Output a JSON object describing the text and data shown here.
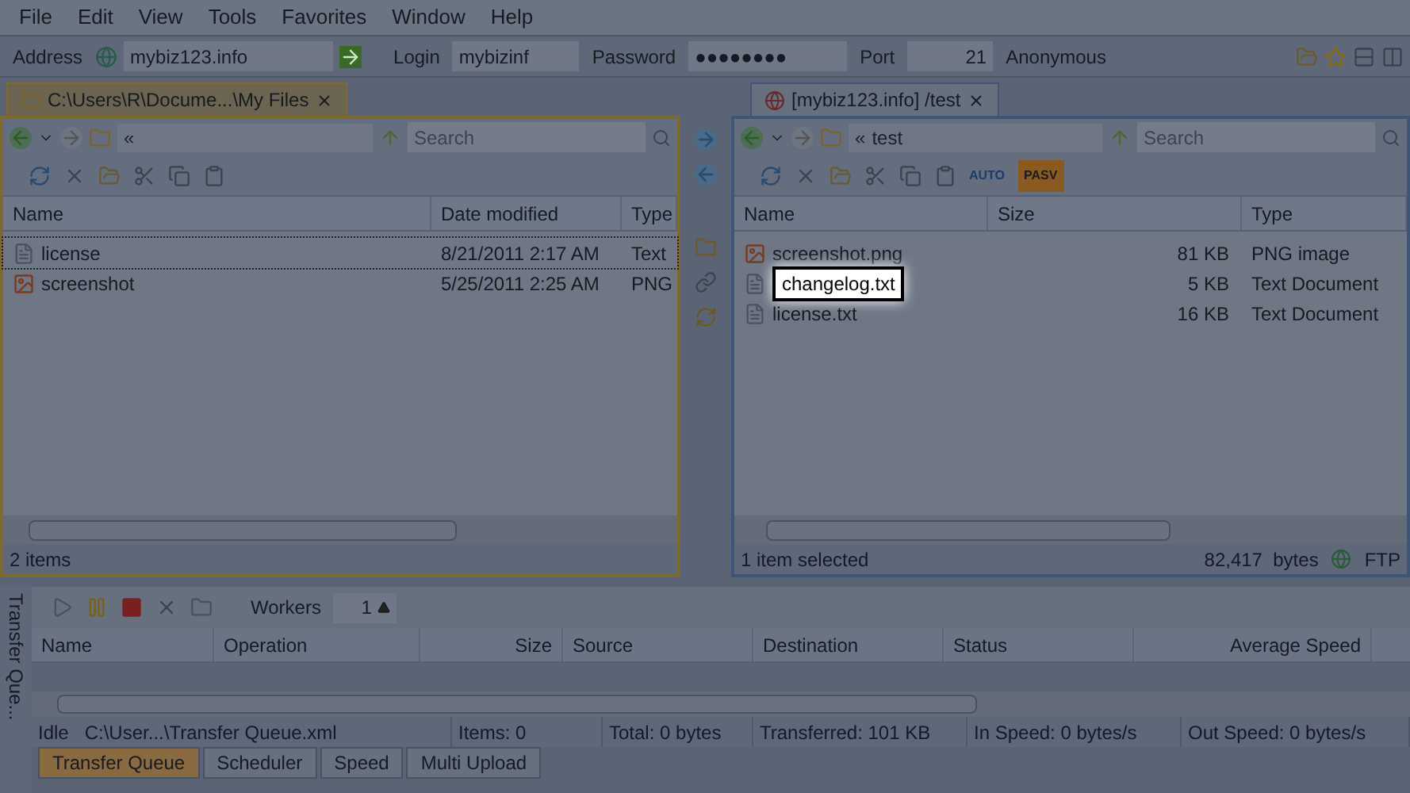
{
  "menu": [
    "File",
    "Edit",
    "View",
    "Tools",
    "Favorites",
    "Window",
    "Help"
  ],
  "connection_bar": {
    "address_label": "Address",
    "address": "mybiz123.info",
    "login_label": "Login",
    "login": "mybizinf",
    "password_label": "Password",
    "password": "●●●●●●●●",
    "port_label": "Port",
    "port": "21",
    "anonymous": "Anonymous"
  },
  "left_pane": {
    "tab_title": "C:\\Users\\R\\Docume...\\My Files",
    "path": "«",
    "search_placeholder": "Search",
    "columns": [
      "Name",
      "Date modified",
      "Type"
    ],
    "rows": [
      {
        "kind": "text",
        "name": "license",
        "date": "8/21/2011 2:17 AM",
        "type": "Text",
        "focused": true
      },
      {
        "kind": "image",
        "name": "screenshot",
        "date": "5/25/2011 2:25 AM",
        "type": "PNG",
        "focused": false
      }
    ],
    "status": "2 items"
  },
  "right_pane": {
    "tab_title": "[mybiz123.info] /test",
    "path": "«",
    "folder": "test",
    "search_placeholder": "Search",
    "pasv": "PASV",
    "auto": "AUTO",
    "columns": [
      "Name",
      "Size",
      "Type"
    ],
    "rows": [
      {
        "kind": "image",
        "name": "screenshot.png",
        "size": "81 KB",
        "type": "PNG image",
        "selected": false
      },
      {
        "kind": "text",
        "name": "changelog.txt",
        "size": "5 KB",
        "type": "Text Document",
        "selected": true
      },
      {
        "kind": "text",
        "name": "license.txt",
        "size": "16 KB",
        "type": "Text Document",
        "selected": false
      }
    ],
    "status": "1 item selected",
    "bytes": "82,417  bytes",
    "protocol": "FTP"
  },
  "queue": {
    "side_label": "Transfer Que...",
    "workers_label": "Workers",
    "workers": "1",
    "columns": [
      "Name",
      "Operation",
      "Size",
      "Source",
      "Destination",
      "Status",
      "Average Speed"
    ],
    "status_cells": [
      "Idle   C:\\User...\\Transfer Queue.xml",
      "Items: 0",
      "Total: 0 bytes",
      "Transferred: 101 KB",
      "In Speed: 0 bytes/s",
      "Out Speed: 0 bytes/s"
    ]
  },
  "bottom_tabs": [
    {
      "label": "Transfer Queue",
      "selected": true
    },
    {
      "label": "Scheduler",
      "selected": false
    },
    {
      "label": "Speed",
      "selected": false
    },
    {
      "label": "Multi Upload",
      "selected": false
    }
  ]
}
